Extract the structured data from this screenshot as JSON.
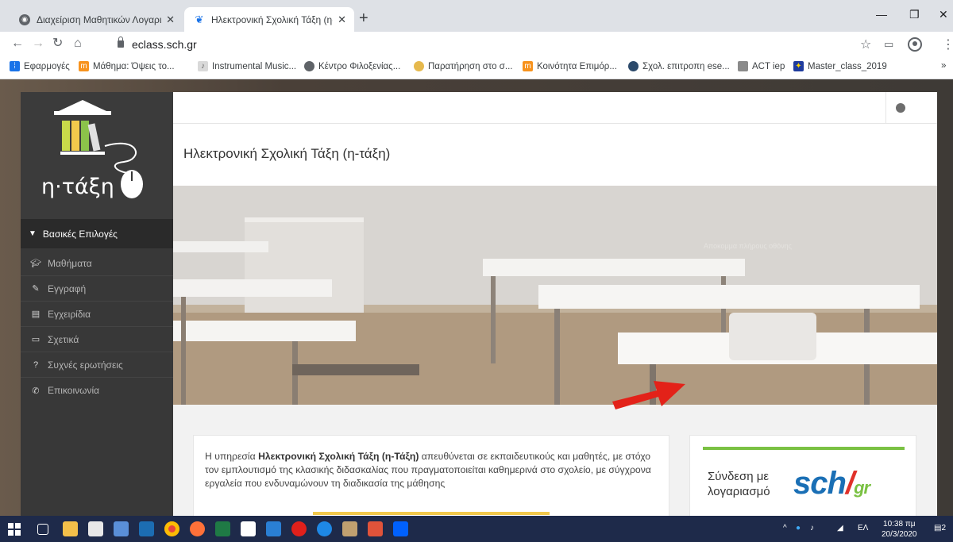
{
  "browser": {
    "tabs": [
      {
        "title": "Διαχείριση Μαθητικών Λογαριασ",
        "active": false
      },
      {
        "title": "Ηλεκτρονική Σχολική Τάξη (η-Τά",
        "active": true
      }
    ],
    "url": "eclass.sch.gr",
    "bookmarks": [
      {
        "label": "Εφαρμογές",
        "icon": "apps-grid-icon"
      },
      {
        "label": "Μάθημα: Όψεις το...",
        "icon": "moodle-icon"
      },
      {
        "label": "Instrumental Music...",
        "icon": "music-icon"
      },
      {
        "label": "Κέντρο Φιλοξενίας...",
        "icon": "globe-icon"
      },
      {
        "label": "Παρατήρηση στο σ...",
        "icon": "site-icon"
      },
      {
        "label": "Κοινότητα Επιμόρ...",
        "icon": "moodle-icon"
      },
      {
        "label": "Σχολ. επιτροπη ese...",
        "icon": "site-icon"
      },
      {
        "label": "ACT iep",
        "icon": "site-icon"
      },
      {
        "label": "Master_class_2019",
        "icon": "eu-flag-icon"
      }
    ],
    "more_bookmarks": "»"
  },
  "sidebar": {
    "logo_text": "η·τάξη",
    "menu_head": "Βασικές Επιλογές",
    "items": [
      {
        "label": "Μαθήματα",
        "icon": "graduation-cap-icon"
      },
      {
        "label": "Εγγραφή",
        "icon": "edit-icon"
      },
      {
        "label": "Εγχειρίδια",
        "icon": "document-icon"
      },
      {
        "label": "Σχετικά",
        "icon": "card-icon"
      },
      {
        "label": "Συχνές ερωτήσεις",
        "icon": "question-icon"
      },
      {
        "label": "Επικοινωνία",
        "icon": "phone-icon"
      }
    ]
  },
  "main": {
    "site_title": "Ηλεκτρονική Σχολική Τάξη (η-τάξη)",
    "hero_caption": "Αποκομμα πλήρους οθόνης",
    "intro": {
      "prefix": "Η υπηρεσία ",
      "bold": "Ηλεκτρονική Σχολική Τάξη (η-Τάξη)",
      "suffix": " απευθύνεται σε εκπαιδευτικούς και μαθητές, με στόχο τον εμπλουτισμό της κλασικής διδασκαλίας που πραγματοποιείται καθημερινά στο σχολείο, με σύγχρονα εργαλεία που ενδυναμώνουν τη διαδικασία της μάθησης"
    },
    "login": {
      "line1": "Σύνδεση με",
      "line2": "λογαριασμό",
      "logo_main": "sch",
      "logo_gr": "gr"
    }
  },
  "taskbar": {
    "lang": "ΕΛ",
    "time": "10:38 πμ",
    "date": "20/3/2020",
    "notifications": "2"
  },
  "colors": {
    "sidebar_bg": "#383838",
    "accent_green": "#7ac143",
    "accent_yellow": "#f2c94c",
    "sch_blue": "#1a6fb5",
    "arrow_red": "#e32219"
  }
}
